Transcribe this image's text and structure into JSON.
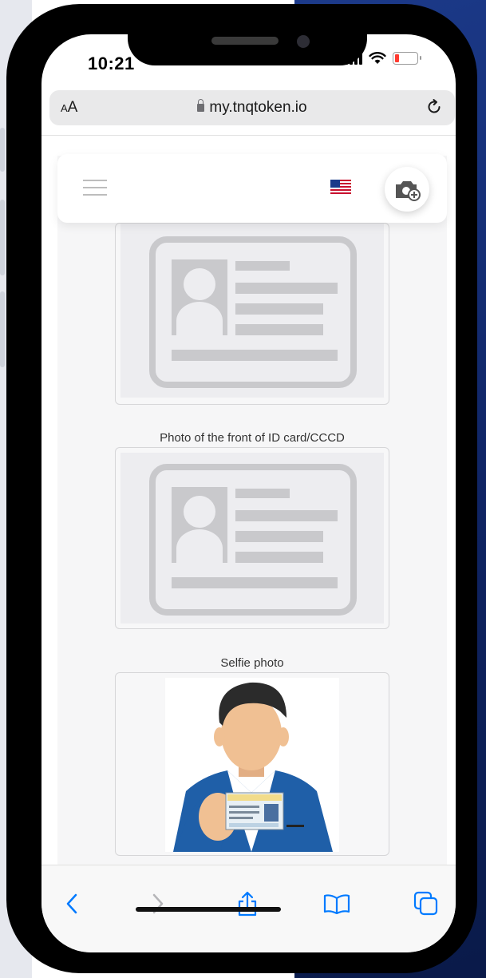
{
  "status_bar": {
    "time": "10:21"
  },
  "browser": {
    "text_size": "AA",
    "url": "my.tnqtoken.io"
  },
  "toolbar": {
    "icons": [
      "back-icon",
      "forward-icon",
      "share-icon",
      "bookmarks-icon",
      "tabs-icon"
    ]
  },
  "header": {
    "language_flag": "us-flag-icon",
    "upload_icon": "camera-plus-icon"
  },
  "documents": {
    "front_caption": "Photo of the front of ID card/CCCD",
    "selfie_caption": "Selfie photo"
  },
  "colors": {
    "accent_blue": "#007aff",
    "battery_low": "#ff3b30",
    "placeholder_gray": "#c9c9cc"
  }
}
